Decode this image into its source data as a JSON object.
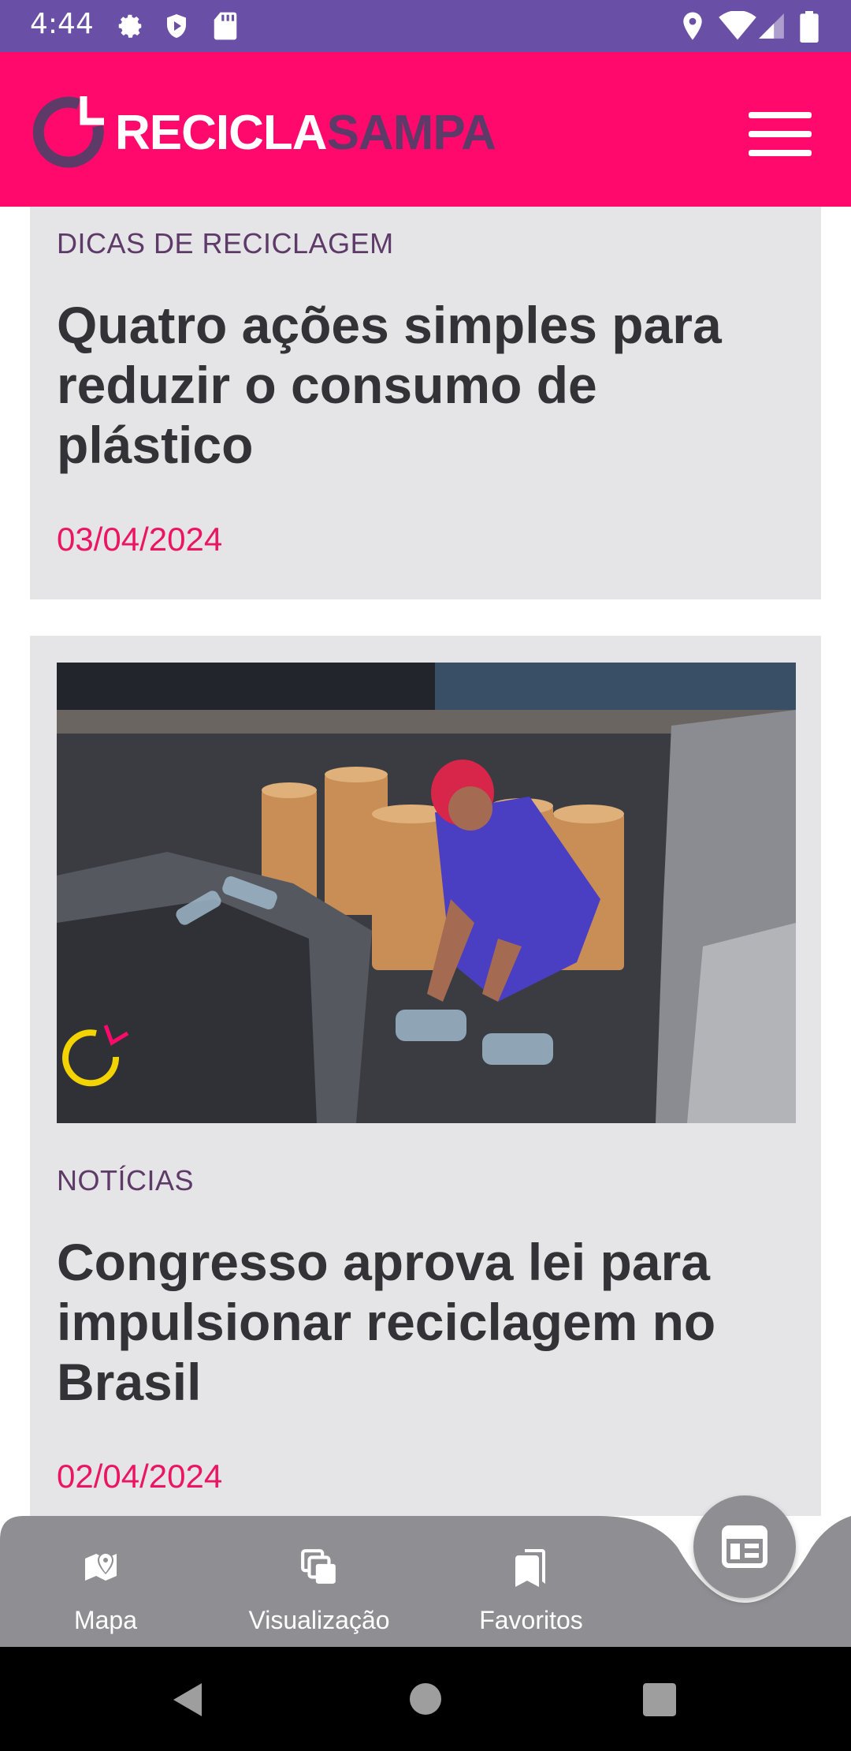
{
  "status_bar": {
    "time": "4:44"
  },
  "header": {
    "logo_part1": "RECICLA",
    "logo_part2": "SAMPA"
  },
  "articles": [
    {
      "category": "DICAS DE RECICLAGEM",
      "title": "Quatro ações simples para reduzir o consumo de plástico",
      "date": "03/04/2024"
    },
    {
      "category": "NOTÍCIAS",
      "title": "Congresso aprova lei para impulsionar reciclagem no Brasil",
      "date": "02/04/2024"
    }
  ],
  "bottom_nav": {
    "items": [
      {
        "label": "Mapa",
        "icon": "map-icon"
      },
      {
        "label": "Visualização",
        "icon": "layers-icon"
      },
      {
        "label": "Favoritos",
        "icon": "bookmark-icon"
      }
    ],
    "fab_icon": "news-icon"
  },
  "colors": {
    "accent": "#ff0a6c",
    "purple": "#5e3a69",
    "date": "#ea1664",
    "card": "#e5e4e6"
  }
}
